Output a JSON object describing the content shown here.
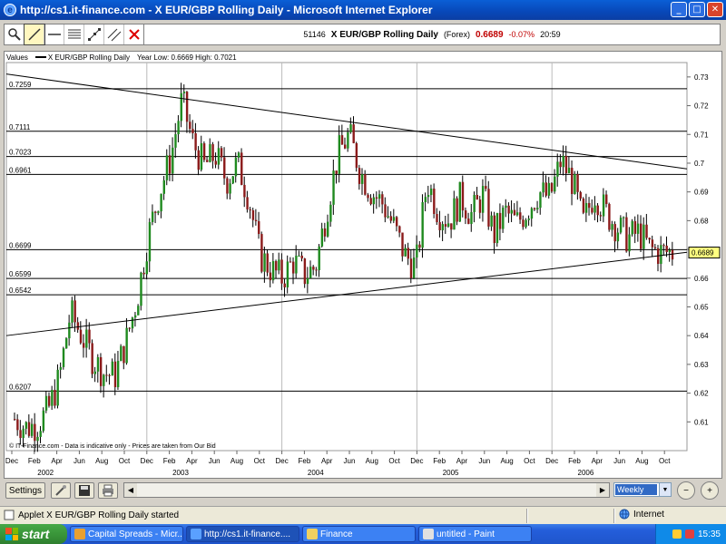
{
  "window": {
    "title": "http://cs1.it-finance.com - X EUR/GBP Rolling Daily - Microsoft Internet Explorer",
    "min": "_",
    "max": "□",
    "close": "✕"
  },
  "tools": [
    {
      "name": "zoom-tool",
      "icon": "magnifier-icon"
    },
    {
      "name": "line-tool",
      "icon": "diagonal-line-icon"
    },
    {
      "name": "horizontal-line-tool",
      "icon": "horizontal-line-icon"
    },
    {
      "name": "fibonacci-tool",
      "icon": "fibonacci-icon"
    },
    {
      "name": "points-tool",
      "icon": "points-icon"
    },
    {
      "name": "channel-tool",
      "icon": "parallel-lines-icon"
    },
    {
      "name": "delete-tool",
      "icon": "red-x-icon"
    }
  ],
  "quote": {
    "code": "51146",
    "name": "X EUR/GBP Rolling Daily",
    "type": "(Forex)",
    "price": "0.6689",
    "change": "-0.07%",
    "time": "20:59"
  },
  "values_bar": {
    "label": "Values",
    "series": "X EUR/GBP Rolling Daily",
    "range": "Year Low: 0.6669  High: 0.7021"
  },
  "chart_data": {
    "type": "candlestick",
    "ylim": [
      0.6,
      0.735
    ],
    "y_ticks": [
      "0.73",
      "0.72",
      "0.71",
      "0.7",
      "0.69",
      "0.68",
      "0.67",
      "0.66",
      "0.65",
      "0.64",
      "0.63",
      "0.62",
      "0.61"
    ],
    "x_tick_labels": [
      "Dec",
      "Feb",
      "Apr",
      "Jun",
      "Aug",
      "Oct",
      "Dec",
      "Feb",
      "Apr",
      "Jun",
      "Aug",
      "Oct",
      "Dec",
      "Feb",
      "Apr",
      "Jun",
      "Aug",
      "Oct",
      "Dec",
      "Feb",
      "Apr",
      "Jun",
      "Aug",
      "Oct",
      "Dec",
      "Feb",
      "Apr",
      "Jun",
      "Aug",
      "Oct"
    ],
    "years": [
      "2002",
      "2003",
      "2004",
      "2005",
      "2006"
    ],
    "horizontal_levels": [
      {
        "value": 0.7259,
        "label": "0.7259"
      },
      {
        "value": 0.7111,
        "label": "0.7111"
      },
      {
        "value": 0.7023,
        "label": "0.7023"
      },
      {
        "value": 0.6961,
        "label": "0.6961"
      },
      {
        "value": 0.6699,
        "label": "0.6699"
      },
      {
        "value": 0.6599,
        "label": "0.6599"
      },
      {
        "value": 0.6542,
        "label": "0.6542"
      },
      {
        "value": 0.6207,
        "label": "0.6207"
      }
    ],
    "current_price": {
      "value": 0.6689,
      "label": "0.6689"
    },
    "trendlines": [
      {
        "name": "upper-trendline",
        "from": [
          0,
          0.731
        ],
        "to": [
          59,
          0.698
        ]
      },
      {
        "name": "lower-trendline",
        "from": [
          0,
          0.64
        ],
        "to": [
          59,
          0.669
        ]
      }
    ],
    "close_path": [
      0.611,
      0.608,
      0.609,
      0.614,
      0.625,
      0.648,
      0.64,
      0.632,
      0.627,
      0.626,
      0.638,
      0.653,
      0.675,
      0.69,
      0.702,
      0.722,
      0.707,
      0.699,
      0.703,
      0.694,
      0.7,
      0.688,
      0.668,
      0.663,
      0.66,
      0.666,
      0.661,
      0.664,
      0.684,
      0.703,
      0.71,
      0.697,
      0.69,
      0.686,
      0.678,
      0.668,
      0.664,
      0.694,
      0.683,
      0.68,
      0.688,
      0.682,
      0.689,
      0.675,
      0.683,
      0.679,
      0.684,
      0.69,
      0.688,
      0.701,
      0.694,
      0.679,
      0.69,
      0.683,
      0.678,
      0.674,
      0.676,
      0.67,
      0.669,
      0.669
    ],
    "copyright": "IT-Finance.com - Data is indicative only - Prices are taken from Our Bid"
  },
  "bottom": {
    "settings_label": "Settings",
    "period_value": "Weekly",
    "zoom_out": "−",
    "zoom_in": "+"
  },
  "status": {
    "message": "Applet X EUR/GBP Rolling Daily started",
    "zone": "Internet"
  },
  "taskbar": {
    "start_label": "start",
    "tasks": [
      {
        "label": "Capital Spreads - Micr...",
        "icon_color": "#e8a030"
      },
      {
        "label": "http://cs1.it-finance....",
        "icon_color": "#5aa0ff"
      },
      {
        "label": "Finance",
        "icon_color": "#f0d060"
      },
      {
        "label": "untitled - Paint",
        "icon_color": "#e0e0e0"
      }
    ],
    "clock": "15:35"
  },
  "colors": {
    "bull": "#1f8a1f",
    "bear": "#8b1a1a",
    "price_tag": "#ffff80"
  }
}
